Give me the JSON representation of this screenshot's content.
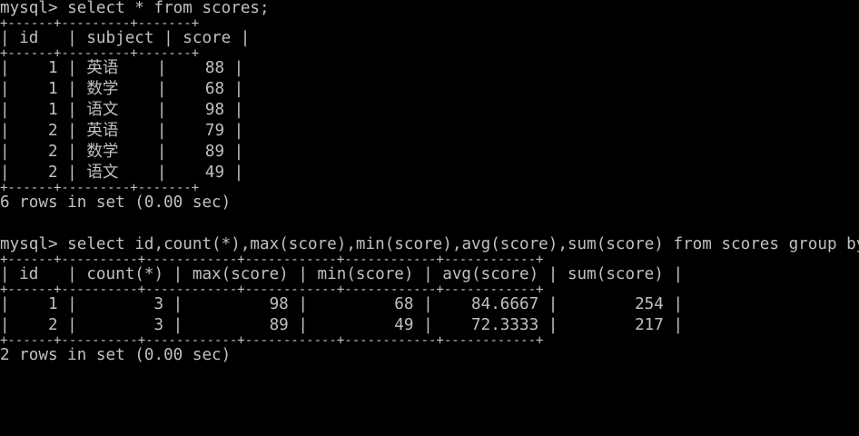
{
  "theme": {
    "background": "#000000",
    "foreground": "#c0c0c0"
  },
  "terminal": {
    "prompt": "mysql>",
    "query1": {
      "command": "select * from scores;",
      "border": "+------+---------+-------+",
      "header": "| id   | subject | score |",
      "rows": [
        "|    1 | 英语    |    88 |",
        "|    1 | 数学    |    68 |",
        "|    1 | 语文    |    98 |",
        "|    2 | 英语    |    79 |",
        "|    2 | 数学    |    89 |",
        "|    2 | 语文    |    49 |"
      ],
      "status": "6 rows in set (0.00 sec)"
    },
    "query2": {
      "command": "select id,count(*),max(score),min(score),avg(score),sum(score) from scores group by id;",
      "border": "+------+----------+------------+------------+------------+------------+",
      "header": "| id   | count(*) | max(score) | min(score) | avg(score) | sum(score) |",
      "rows": [
        "|    1 |        3 |         98 |         68 |    84.6667 |        254 |",
        "|    2 |        3 |         89 |         49 |    72.3333 |        217 |"
      ],
      "status": "2 rows in set (0.00 sec)"
    }
  }
}
